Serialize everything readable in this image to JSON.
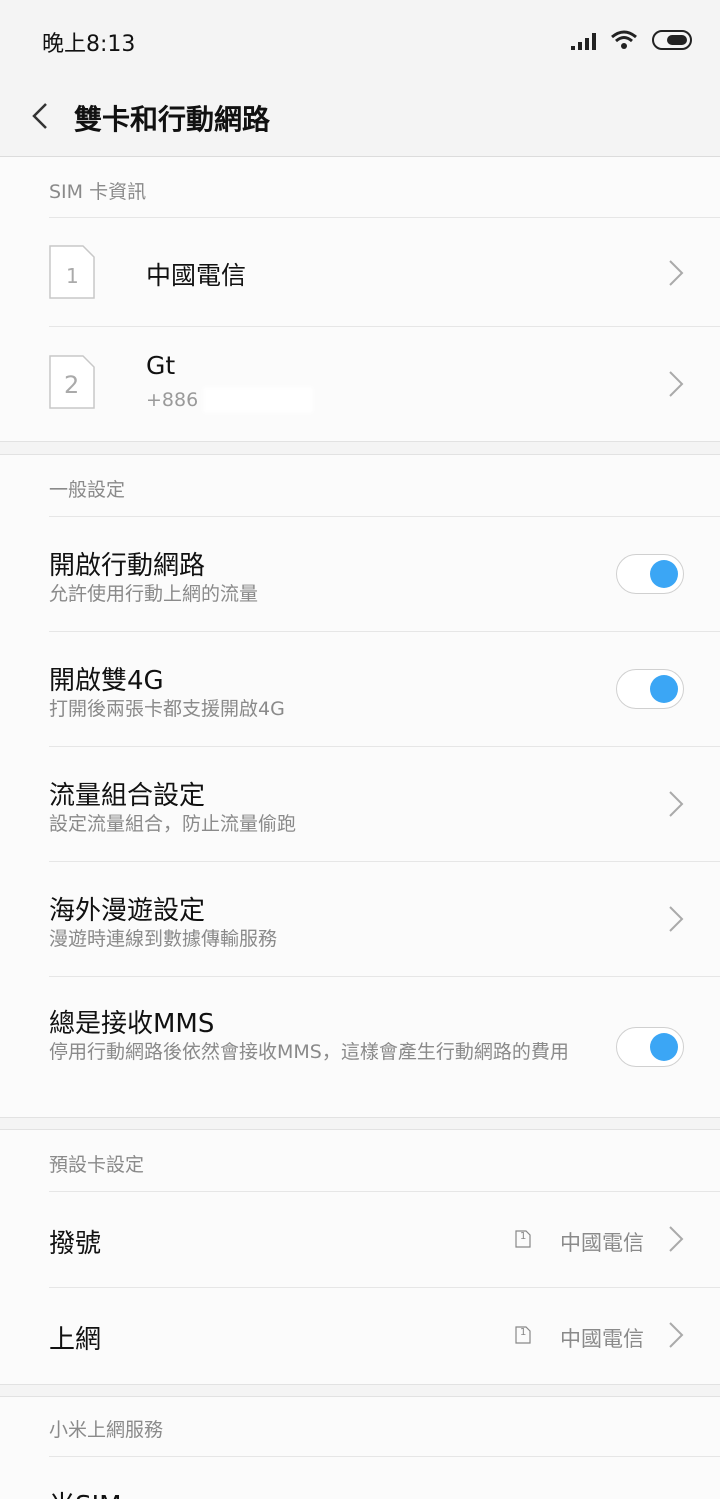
{
  "status_bar": {
    "time": "晚上8:13"
  },
  "header": {
    "title": "雙卡和行動網路"
  },
  "sim_info": {
    "heading": "SIM 卡資訊",
    "cards": [
      {
        "slot": "1",
        "name": "中國電信",
        "number": ""
      },
      {
        "slot": "2",
        "name": "Gt",
        "number": "+886"
      }
    ]
  },
  "general": {
    "heading": "一般設定",
    "items": [
      {
        "title": "開啟行動網路",
        "subtitle": "允許使用行動上網的流量",
        "control": "toggle",
        "on": true
      },
      {
        "title": "開啟雙4G",
        "subtitle": "打開後兩張卡都支援開啟4G",
        "control": "toggle",
        "on": true
      },
      {
        "title": "流量組合設定",
        "subtitle": "設定流量組合，防止流量偷跑",
        "control": "chevron"
      },
      {
        "title": "海外漫遊設定",
        "subtitle": "漫遊時連線到數據傳輸服務",
        "control": "chevron"
      },
      {
        "title": "總是接收MMS",
        "subtitle": "停用行動網路後依然會接收MMS，這樣會產生行動網路的費用",
        "control": "toggle",
        "on": true
      }
    ]
  },
  "default_card": {
    "heading": "預設卡設定",
    "items": [
      {
        "title": "撥號",
        "sim_slot": "1",
        "value": "中國電信"
      },
      {
        "title": "上網",
        "sim_slot": "1",
        "value": "中國電信"
      }
    ]
  },
  "mi_services": {
    "heading": "小米上網服務",
    "items": [
      {
        "title": "米SIM"
      }
    ]
  },
  "colors": {
    "accent": "#3ba6f5",
    "background": "#f4f4f4",
    "card": "#fbfbfb"
  }
}
